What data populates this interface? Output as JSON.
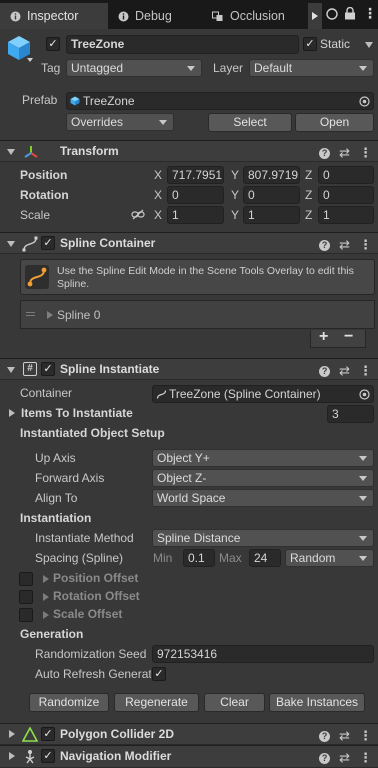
{
  "tabs": [
    {
      "label": "Inspector"
    },
    {
      "label": "Debug"
    },
    {
      "label": "Occlusion"
    }
  ],
  "object": {
    "name": "TreeZone",
    "static_label": "Static",
    "tag_label": "Tag",
    "tag_value": "Untagged",
    "layer_label": "Layer",
    "layer_value": "Default",
    "prefab_label": "Prefab",
    "prefab_value": "TreeZone",
    "overrides_label": "Overrides",
    "select_label": "Select",
    "open_label": "Open"
  },
  "transform": {
    "title": "Transform",
    "position_label": "Position",
    "rotation_label": "Rotation",
    "scale_label": "Scale",
    "position": {
      "x": "717.7951",
      "y": "807.9719",
      "z": "0"
    },
    "rotation": {
      "x": "0",
      "y": "0",
      "z": "0"
    },
    "scale": {
      "x": "1",
      "y": "1",
      "z": "1"
    },
    "axis_x": "X",
    "axis_y": "Y",
    "axis_z": "Z"
  },
  "spline_container": {
    "title": "Spline Container",
    "info": "Use the Spline Edit Mode in the Scene Tools Overlay to edit this Spline.",
    "spline_item": "Spline 0",
    "add": "+",
    "remove": "−"
  },
  "spline_instantiate": {
    "title": "Spline Instantiate",
    "container_label": "Container",
    "container_value": "TreeZone (Spline Container)",
    "items_label": "Items To Instantiate",
    "items_count": "3",
    "setup_header": "Instantiated Object Setup",
    "up_axis_label": "Up Axis",
    "up_axis_value": "Object Y+",
    "forward_axis_label": "Forward Axis",
    "forward_axis_value": "Object Z-",
    "align_to_label": "Align To",
    "align_to_value": "World Space",
    "instantiation_header": "Instantiation",
    "method_label": "Instantiate Method",
    "method_value": "Spline Distance",
    "spacing_label": "Spacing (Spline)",
    "min_label": "Min",
    "min_value": "0.1",
    "max_label": "Max",
    "max_value": "24",
    "spacing_mode": "Random",
    "position_offset": "Position Offset",
    "rotation_offset": "Rotation Offset",
    "scale_offset": "Scale Offset",
    "generation_header": "Generation",
    "seed_label": "Randomization Seed",
    "seed_value": "972153416",
    "auto_refresh_label": "Auto Refresh Generation",
    "randomize": "Randomize",
    "regenerate": "Regenerate",
    "clear": "Clear",
    "bake": "Bake Instances"
  },
  "polygon_collider": {
    "title": "Polygon Collider 2D"
  },
  "nav_modifier": {
    "title": "Navigation Modifier"
  },
  "colors": {
    "background": "#383838",
    "header": "#3d3d3d",
    "field": "#2a2a2a",
    "accent": "#4a9be0"
  }
}
